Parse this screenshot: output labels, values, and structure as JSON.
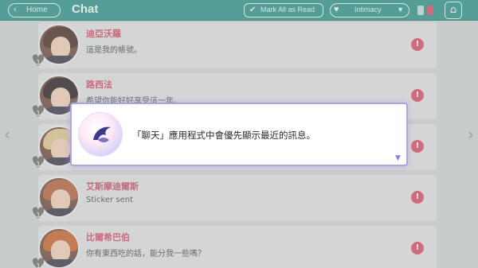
{
  "header": {
    "home_label": "Home",
    "title": "Chat",
    "mark_all_read_label": "Mark All as Read",
    "sort_label": "Intimacy",
    "bg_color": "#2e8f86"
  },
  "chats": [
    {
      "name": "迪亞沃羅",
      "preview": "這是我的帳號。",
      "level": "1",
      "unread": "!",
      "hair": "#4a2e24"
    },
    {
      "name": "路西法",
      "preview": "希望你能好好享受這一年。",
      "level": "1",
      "unread": "!",
      "hair": "#2a2024"
    },
    {
      "name": "",
      "preview": "",
      "level": "1",
      "unread": "!",
      "hair": "#d8c08a"
    },
    {
      "name": "艾斯摩迪爾斯",
      "preview": "Sticker sent",
      "level": "1",
      "unread": "!",
      "hair": "#b0603a"
    },
    {
      "name": "比爾希巴伯",
      "preview": "你有東西吃的話，能分我一些嗎？",
      "level": "1",
      "unread": "!",
      "hair": "#c0602a"
    }
  ],
  "dialog": {
    "message": "「聊天」應用程式中會優先顯示最近的訊息。",
    "logo_icon": "app-bird-logo-icon"
  },
  "colors": {
    "accent": "#c94a63",
    "unread_badge": "#d24d62",
    "dialog_border": "#a7a7d8"
  }
}
